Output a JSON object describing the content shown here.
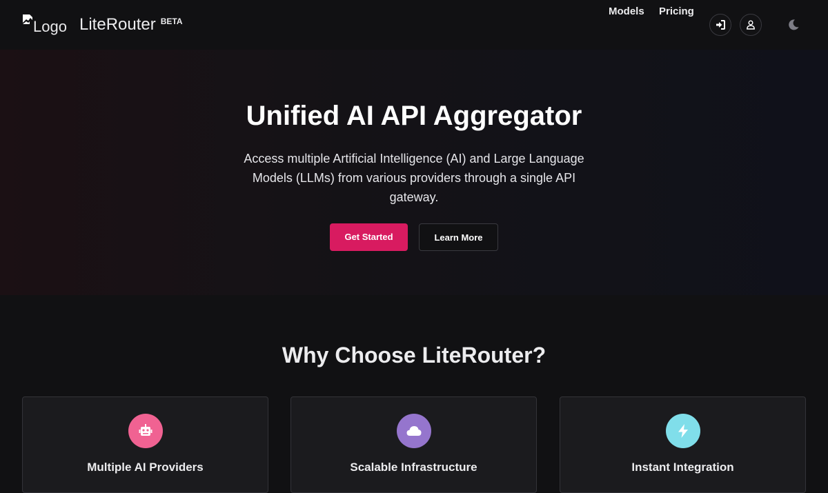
{
  "header": {
    "logo_alt": "Logo",
    "brand_name": "LiteRouter",
    "badge": "BETA",
    "nav": [
      {
        "label": "Models"
      },
      {
        "label": "Pricing"
      }
    ]
  },
  "hero": {
    "title": "Unified AI API Aggregator",
    "subtitle": "Access multiple Artificial Intelligence (AI) and Large Language Models (LLMs) from various providers through a single API gateway.",
    "primary_button": "Get Started",
    "secondary_button": "Learn More"
  },
  "features": {
    "title": "Why Choose LiteRouter?",
    "cards": [
      {
        "icon": "robot-icon",
        "color": "#f06292",
        "title": "Multiple AI Providers"
      },
      {
        "icon": "cloud-icon",
        "color": "#9575cd",
        "title": "Scalable Infrastructure"
      },
      {
        "icon": "bolt-icon",
        "color": "#80deea",
        "title": "Instant Integration"
      }
    ]
  },
  "colors": {
    "accent": "#d81b60",
    "background": "#111113"
  }
}
